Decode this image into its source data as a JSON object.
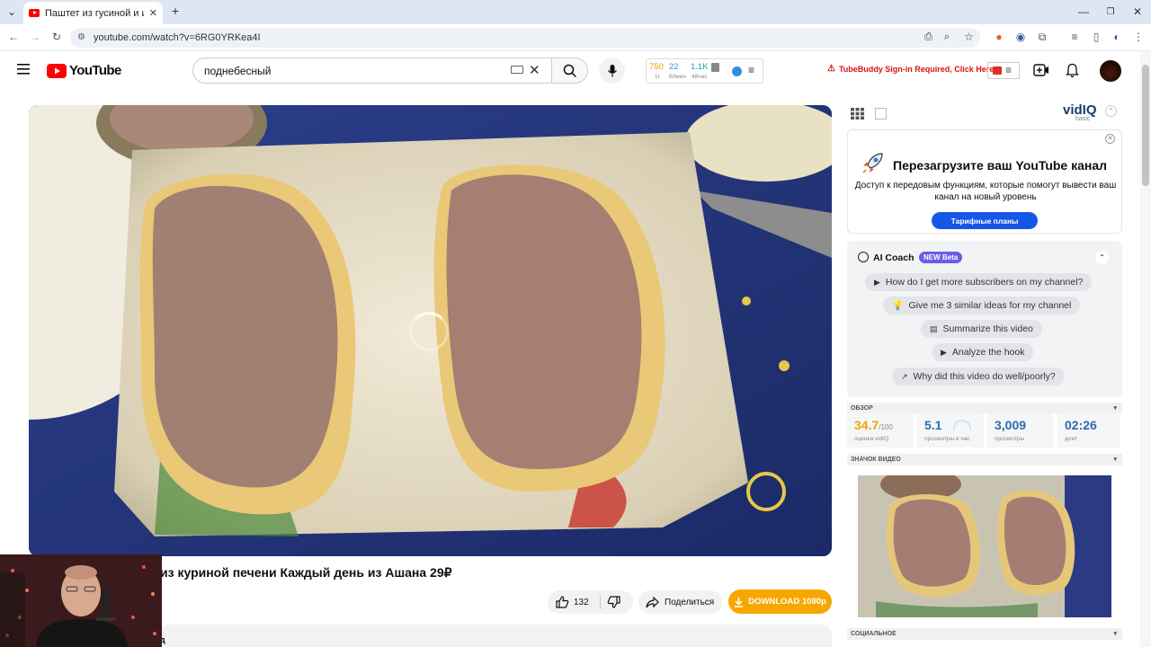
{
  "browser": {
    "tab_title": "Паштет из гусиной и из курин",
    "tab_close": "✕",
    "new_tab": "+",
    "url": "youtube.com/watch?v=6RG0YRKea4I"
  },
  "masthead": {
    "logo_text": "YouTube",
    "search_value": "поднебесный",
    "stats": {
      "val1": "750",
      "val2": "22",
      "val3": "1.1K",
      "lab1": "1г",
      "lab2": "60мин",
      "lab3": "48час"
    },
    "tubebuddy_notice": "TubeBuddy Sign-in Required, Click Here"
  },
  "video": {
    "title": "из куриной печени Каждый день из Ашана 29₽",
    "likes": "132",
    "share_label": "Поделиться",
    "download_label": "DOWNLOAD 1080p",
    "description_peek": "д"
  },
  "vidiq": {
    "brand": "vidIQ",
    "tier": "basic",
    "promo": {
      "title": "Перезагрузите ваш YouTube канал",
      "text": "Доступ к передовым функциям, которые помогут вывести ваш канал на новый уровень",
      "button": "Тарифные планы"
    },
    "coach": {
      "title": "AI Coach",
      "badge": "NEW Beta",
      "questions": [
        "How do I get more subscribers on my channel?",
        "Give me 3 similar ideas for my channel",
        "Summarize this video",
        "Analyze the hook",
        "Why did this video do well/poorly?"
      ]
    },
    "overview": {
      "section_label": "ОБЗОР",
      "score_value": "34.7",
      "score_max": "/100",
      "score_label": "оценка vidIQ",
      "views_per_hour": "5.1",
      "views_per_hour_label": "просмотры в час",
      "views": "3,009",
      "views_label": "просмотры",
      "length": "02:26",
      "length_label": "длит"
    },
    "thumbnail_section": "ЗНАЧОК ВИДЕО",
    "social_section": "СОЦИАЛЬНОЕ"
  }
}
